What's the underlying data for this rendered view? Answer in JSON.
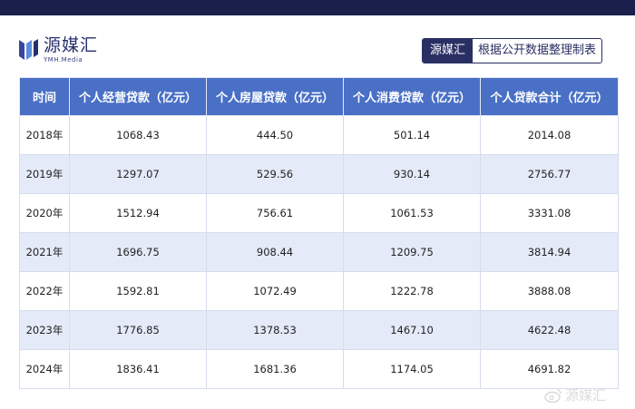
{
  "header": {
    "brand_name": "源媒汇",
    "brand_sub": "YMH.Media",
    "source_brand": "源媒汇",
    "source_text": "根据公开数据整理制表"
  },
  "table": {
    "columns": [
      "时间",
      "个人经营贷款（亿元）",
      "个人房屋贷款（亿元）",
      "个人消费贷款（亿元）",
      "个人贷款合计（亿元）"
    ],
    "rows": [
      [
        "2018年",
        "1068.43",
        "444.50",
        "501.14",
        "2014.08"
      ],
      [
        "2019年",
        "1297.07",
        "529.56",
        "930.14",
        "2756.77"
      ],
      [
        "2020年",
        "1512.94",
        "756.61",
        "1061.53",
        "3331.08"
      ],
      [
        "2021年",
        "1696.75",
        "908.44",
        "1209.75",
        "3814.94"
      ],
      [
        "2022年",
        "1592.81",
        "1072.49",
        "1222.78",
        "3888.08"
      ],
      [
        "2023年",
        "1776.85",
        "1378.53",
        "1467.10",
        "4622.48"
      ],
      [
        "2024年",
        "1836.41",
        "1681.36",
        "1174.05",
        "4691.82"
      ]
    ]
  },
  "watermark": {
    "text": "源媒汇",
    "icon": "weibo-icon"
  },
  "colors": {
    "header_bg": "#4a70c6",
    "stripe": "#e4eaf8",
    "topbar": "#1b1f4c",
    "brand": "#27306b"
  }
}
